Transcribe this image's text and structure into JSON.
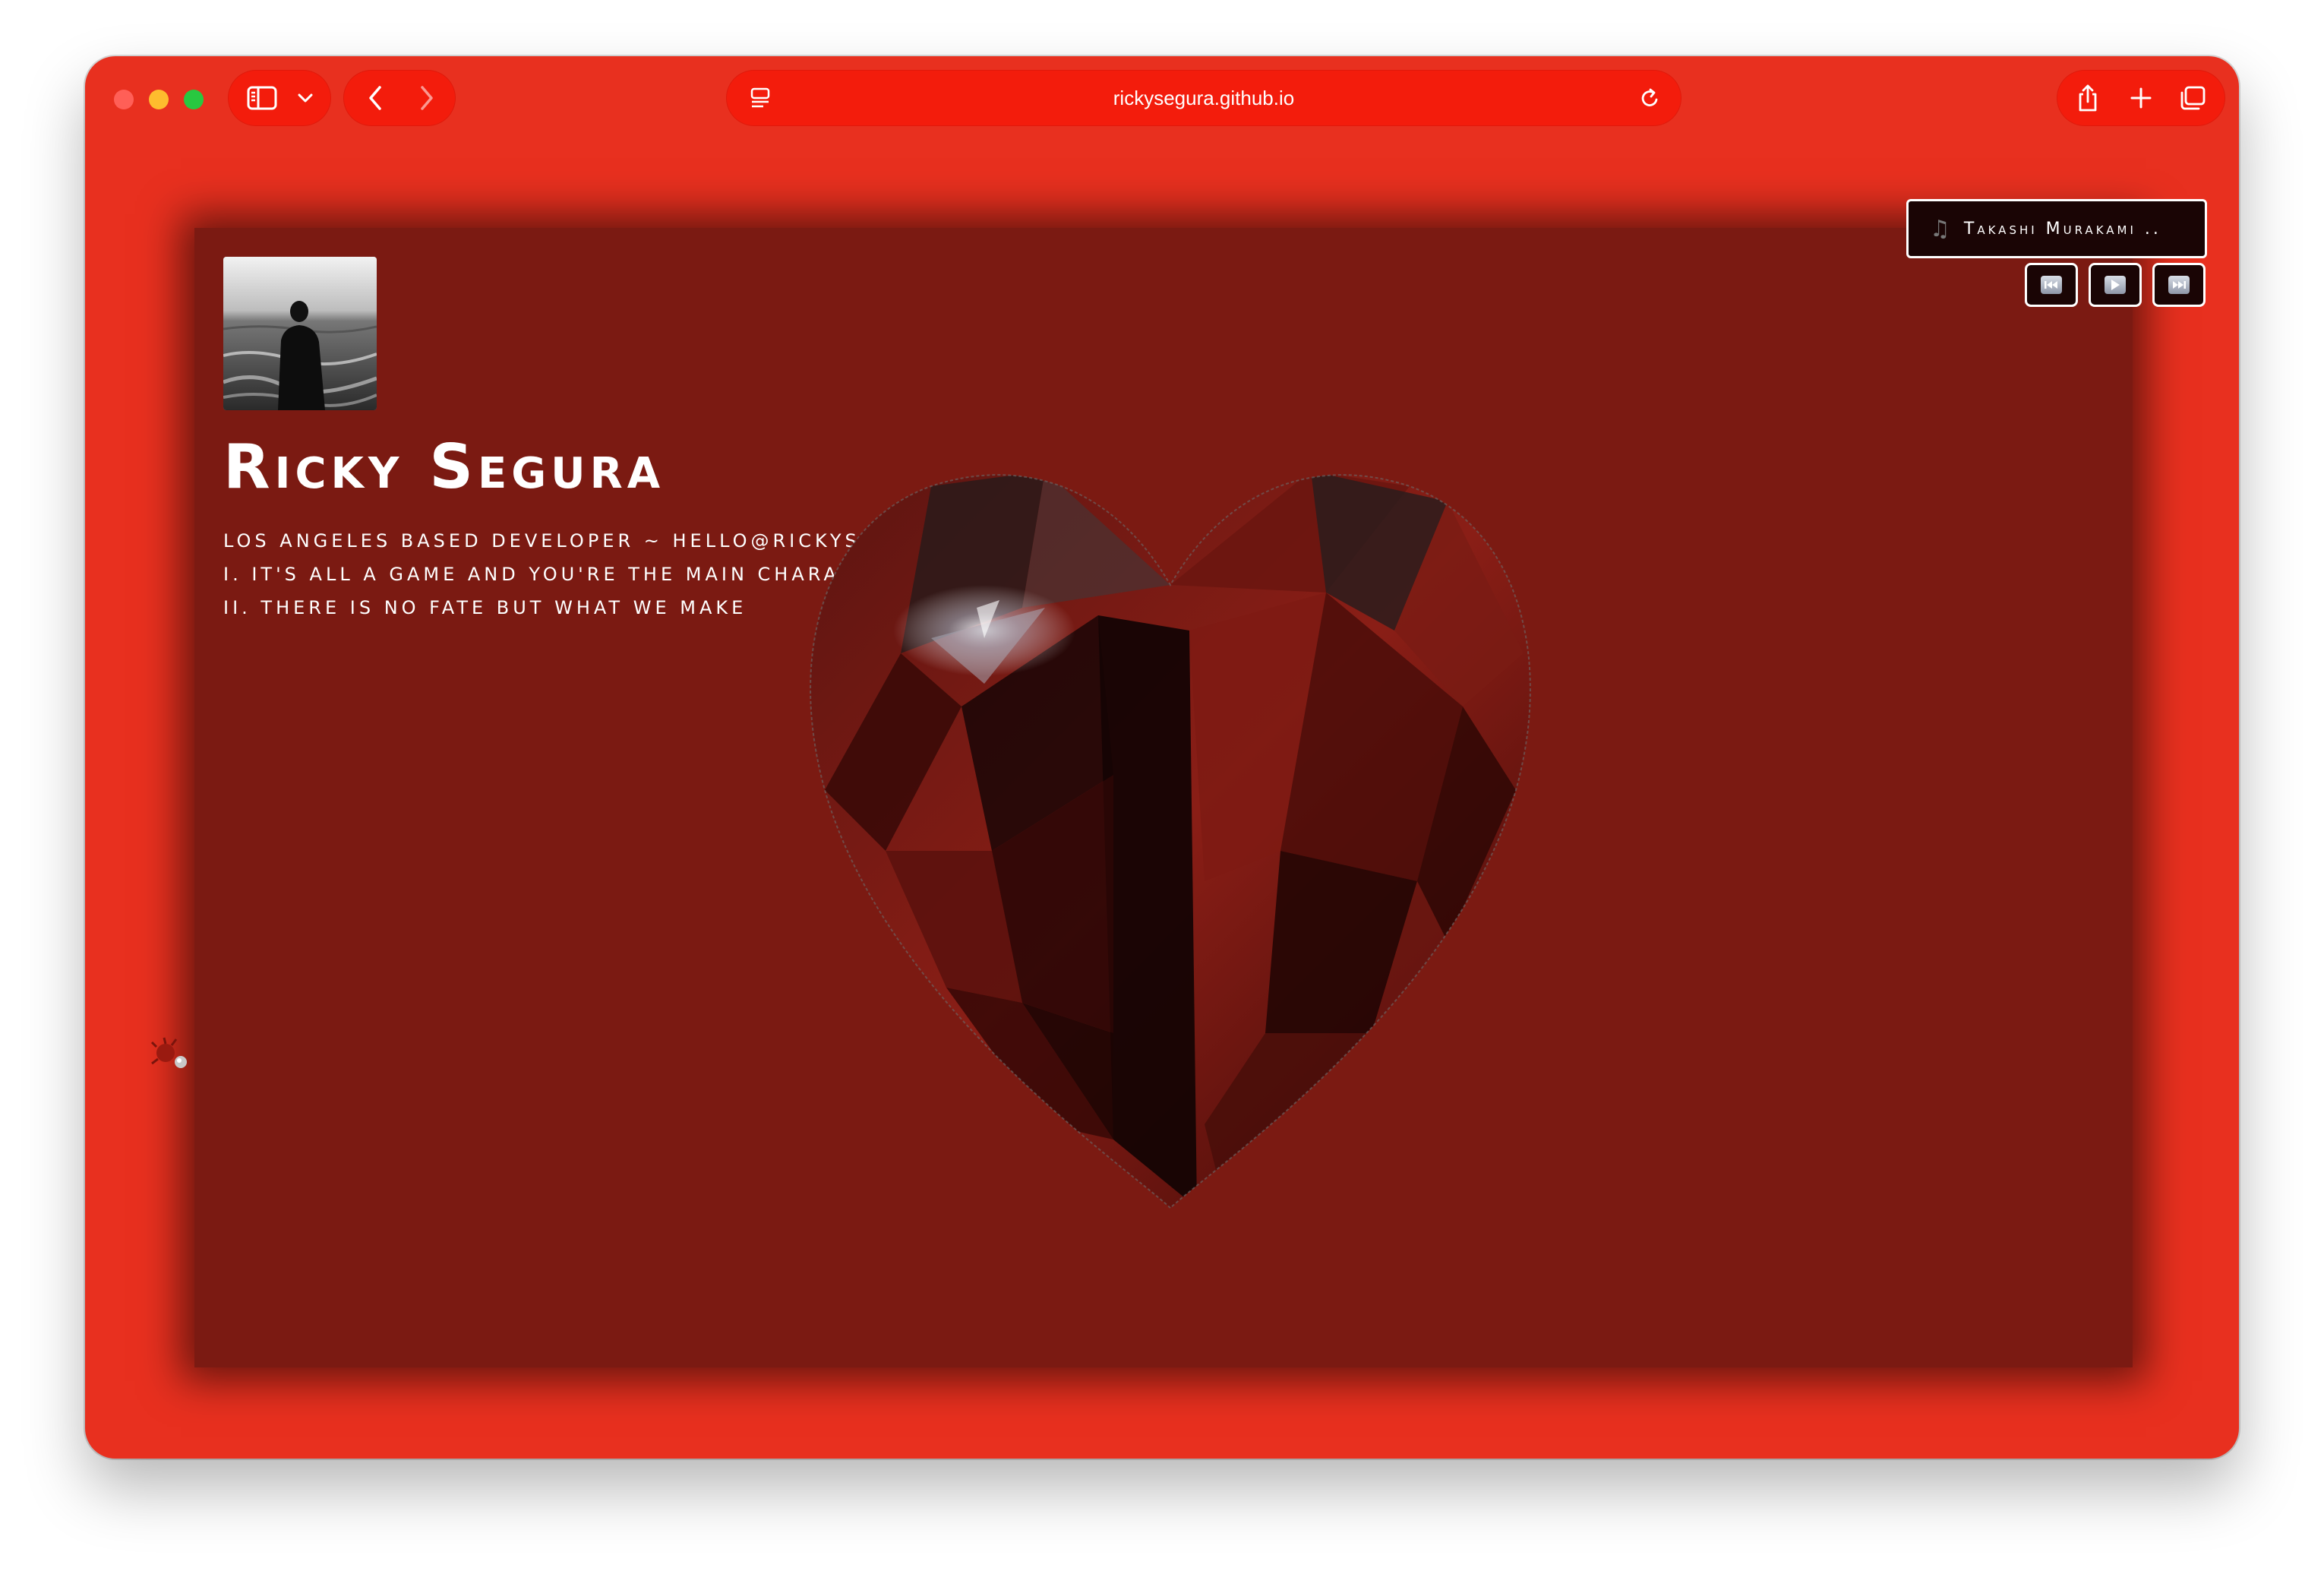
{
  "browser": {
    "url": "rickysegura.github.io",
    "colors": {
      "window": "#e8301f",
      "toolbar_pill": "#f31c0c",
      "card": "#7b1a12"
    },
    "icons": {
      "sidebar": "sidebar-icon",
      "chevron": "chevron-down-icon",
      "back": "back-arrow-icon",
      "forward": "forward-arrow-icon",
      "page_menu": "page-menu-icon",
      "reload": "reload-icon",
      "share": "share-icon",
      "new_tab": "plus-icon",
      "tabs": "tab-overview-icon"
    }
  },
  "profile": {
    "name": "Ricky Segura",
    "bio_lines": [
      "los angeles based developer ~ hello@rickysegura.dev",
      "I. it's all a game and you're the main character",
      "II. there is no fate but what we make"
    ]
  },
  "player": {
    "track": "Takashi Murakami ..",
    "icons": {
      "note": "music-note-icon",
      "prev": "rewind-icon",
      "play": "play-icon",
      "next": "fast-forward-icon"
    }
  }
}
